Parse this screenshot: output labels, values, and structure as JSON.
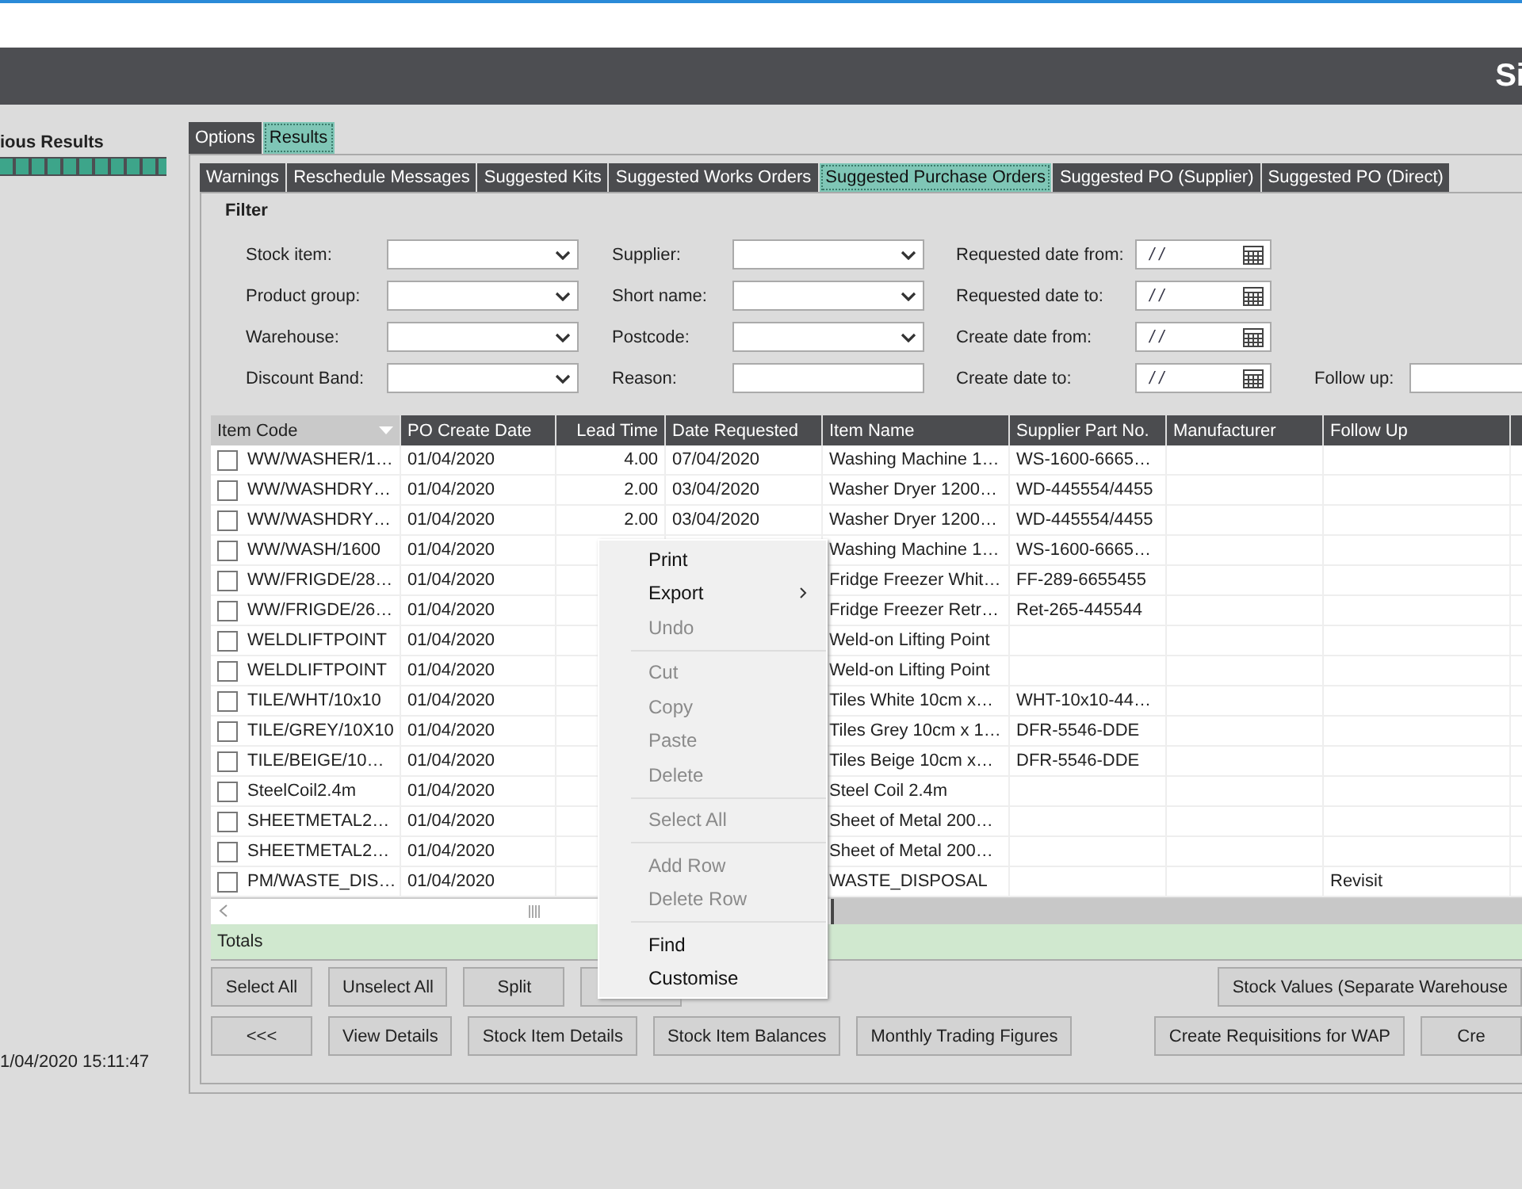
{
  "header": {
    "logo": "Si"
  },
  "left_panel": {
    "title": "ious Results",
    "progress": {
      "level": 1
    },
    "timestamp": "1/04/2020 15:11:47"
  },
  "outer_tabs": [
    {
      "label": "Options",
      "selected": false
    },
    {
      "label": "Results",
      "selected": true
    }
  ],
  "inner_tabs": [
    {
      "label": "Warnings",
      "selected": false
    },
    {
      "label": "Reschedule Messages",
      "selected": false
    },
    {
      "label": "Suggested Kits",
      "selected": false
    },
    {
      "label": "Suggested Works Orders",
      "selected": false
    },
    {
      "label": "Suggested Purchase Orders",
      "selected": true
    },
    {
      "label": "Suggested PO (Supplier)",
      "selected": false
    },
    {
      "label": "Suggested PO (Direct)",
      "selected": false
    }
  ],
  "filter": {
    "title": "Filter",
    "rows": [
      [
        {
          "label": "Stock item:",
          "kind": "dropdown"
        },
        {
          "label": "Supplier:",
          "kind": "dropdown"
        },
        {
          "label": "Requested date from:",
          "kind": "date",
          "value": "/ /"
        }
      ],
      [
        {
          "label": "Product group:",
          "kind": "dropdown"
        },
        {
          "label": "Short name:",
          "kind": "dropdown"
        },
        {
          "label": "Requested date to:",
          "kind": "date",
          "value": "/ /"
        }
      ],
      [
        {
          "label": "Warehouse:",
          "kind": "dropdown"
        },
        {
          "label": "Postcode:",
          "kind": "dropdown"
        },
        {
          "label": "Create date from:",
          "kind": "date",
          "value": "/ /"
        }
      ],
      [
        {
          "label": "Discount Band:",
          "kind": "dropdown"
        },
        {
          "label": "Reason:",
          "kind": "text"
        },
        {
          "label": "Create date to:",
          "kind": "date",
          "value": "/ /"
        },
        {
          "label": "Follow up:",
          "kind": "text"
        }
      ]
    ]
  },
  "grid": {
    "columns": [
      {
        "label": "Item Code",
        "sorted": true
      },
      {
        "label": "PO Create Date",
        "sorted": false
      },
      {
        "label": "Lead Time",
        "sorted": false
      },
      {
        "label": "Date Requested",
        "sorted": false
      },
      {
        "label": "Item Name",
        "sorted": false
      },
      {
        "label": "Supplier Part No.",
        "sorted": false
      },
      {
        "label": "Manufacturer",
        "sorted": false
      },
      {
        "label": "Follow Up",
        "sorted": false
      }
    ],
    "rows": [
      {
        "checked": false,
        "item_code": "WW/WASHER/1…",
        "po_create_date": "01/04/2020",
        "lead_time": "4.00",
        "date_requested": "07/04/2020",
        "item_name": "Washing Machine 1…",
        "supplier_part_no": "WS-1600-6665…"
      },
      {
        "checked": false,
        "item_code": "WW/WASHDRY…",
        "po_create_date": "01/04/2020",
        "lead_time": "2.00",
        "date_requested": "03/04/2020",
        "item_name": "Washer Dryer 1200…",
        "supplier_part_no": "WD-445554/4455"
      },
      {
        "checked": false,
        "item_code": "WW/WASHDRY…",
        "po_create_date": "01/04/2020",
        "lead_time": "2.00",
        "date_requested": "03/04/2020",
        "item_name": "Washer Dryer 1200…",
        "supplier_part_no": "WD-445554/4455"
      },
      {
        "checked": false,
        "item_code": "WW/WASH/1600",
        "po_create_date": "01/04/2020",
        "item_name": "Washing Machine 1…",
        "supplier_part_no": "WS-1600-6665…"
      },
      {
        "checked": false,
        "item_code": "WW/FRIGDE/28…",
        "po_create_date": "01/04/2020",
        "item_name": "Fridge Freezer Whit…",
        "supplier_part_no": "FF-289-6655455"
      },
      {
        "checked": false,
        "item_code": "WW/FRIGDE/26…",
        "po_create_date": "01/04/2020",
        "item_name": "Fridge Freezer Retr…",
        "supplier_part_no": "Ret-265-445544"
      },
      {
        "checked": false,
        "item_code": "WELDLIFTPOINT",
        "po_create_date": "01/04/2020",
        "item_name": "Weld-on Lifting Point"
      },
      {
        "checked": false,
        "item_code": "WELDLIFTPOINT",
        "po_create_date": "01/04/2020",
        "item_name": "Weld-on Lifting Point"
      },
      {
        "checked": false,
        "item_code": "TILE/WHT/10x10",
        "po_create_date": "01/04/2020",
        "item_name": "Tiles White 10cm x…",
        "supplier_part_no": "WHT-10x10-44…"
      },
      {
        "checked": false,
        "item_code": "TILE/GREY/10X10",
        "po_create_date": "01/04/2020",
        "item_name": "Tiles Grey 10cm x 1…",
        "supplier_part_no": "DFR-5546-DDE"
      },
      {
        "checked": false,
        "item_code": "TILE/BEIGE/10…",
        "po_create_date": "01/04/2020",
        "item_name": "Tiles Beige 10cm x…",
        "supplier_part_no": "DFR-5546-DDE"
      },
      {
        "checked": false,
        "item_code": "SteelCoil2.4m",
        "po_create_date": "01/04/2020",
        "item_name": "Steel Coil 2.4m"
      },
      {
        "checked": false,
        "item_code": "SHEETMETAL2…",
        "po_create_date": "01/04/2020",
        "item_name": "Sheet of Metal 200…"
      },
      {
        "checked": false,
        "item_code": "SHEETMETAL2…",
        "po_create_date": "01/04/2020",
        "item_name": "Sheet of Metal 200…"
      },
      {
        "checked": false,
        "item_code": "PM/WASTE_DIS…",
        "po_create_date": "01/04/2020",
        "item_name": "WASTE_DISPOSAL",
        "follow_up": "Revisit"
      }
    ],
    "totals_label": "Totals"
  },
  "context_menu": [
    {
      "kind": "item",
      "label": "Print",
      "disabled": false,
      "has_submenu": false
    },
    {
      "kind": "item",
      "label": "Export",
      "disabled": false,
      "has_submenu": true
    },
    {
      "kind": "item",
      "label": "Undo",
      "disabled": true,
      "has_submenu": false
    },
    {
      "kind": "separator"
    },
    {
      "kind": "item",
      "label": "Cut",
      "disabled": true,
      "has_submenu": false
    },
    {
      "kind": "item",
      "label": "Copy",
      "disabled": true,
      "has_submenu": false
    },
    {
      "kind": "item",
      "label": "Paste",
      "disabled": true,
      "has_submenu": false
    },
    {
      "kind": "item",
      "label": "Delete",
      "disabled": true,
      "has_submenu": false
    },
    {
      "kind": "separator"
    },
    {
      "kind": "item",
      "label": "Select All",
      "disabled": true,
      "has_submenu": false
    },
    {
      "kind": "separator"
    },
    {
      "kind": "item",
      "label": "Add Row",
      "disabled": true,
      "has_submenu": false
    },
    {
      "kind": "item",
      "label": "Delete Row",
      "disabled": true,
      "has_submenu": false
    },
    {
      "kind": "separator"
    },
    {
      "kind": "item",
      "label": "Find",
      "disabled": false,
      "has_submenu": false
    },
    {
      "kind": "item",
      "label": "Customise",
      "disabled": false,
      "has_submenu": false
    }
  ],
  "button_rows": [
    {
      "left": [
        "Select All",
        "Unselect All",
        "Split"
      ],
      "right": [
        "Stock Values (Separate Warehouse"
      ]
    },
    {
      "left": [
        "<<<",
        "View Details",
        "Stock Item Details",
        "Stock Item Balances",
        "Monthly Trading Figures"
      ],
      "right": [
        "Create Requisitions for WAP",
        "Cre"
      ]
    }
  ]
}
